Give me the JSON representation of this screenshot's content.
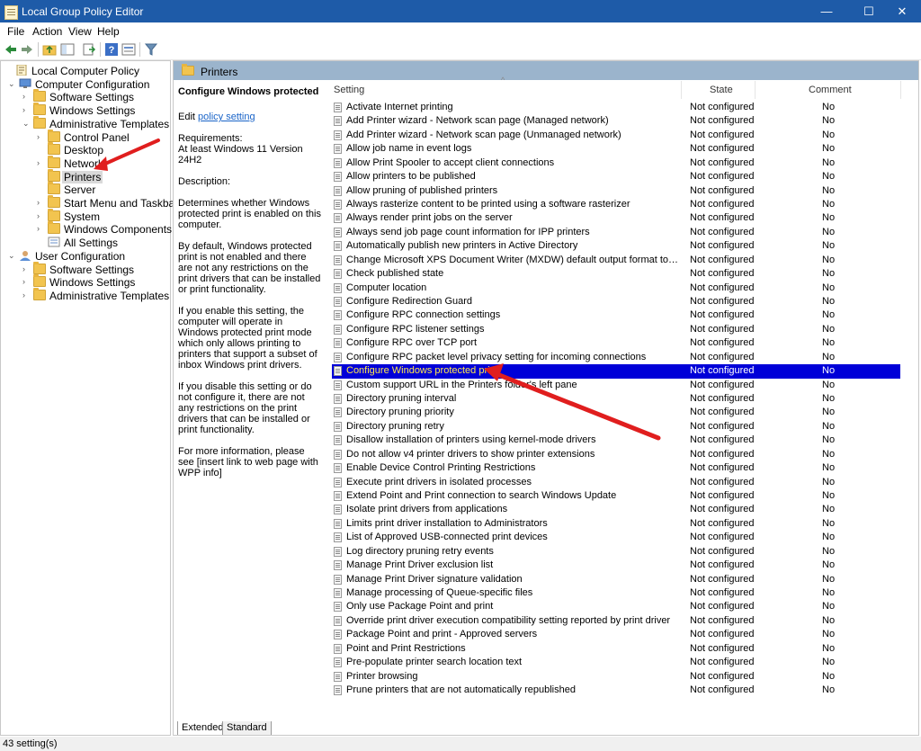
{
  "window": {
    "title": "Local Group Policy Editor",
    "minimize": "—",
    "maximize": "☐",
    "close": "✕"
  },
  "menu": [
    "File",
    "Action",
    "View",
    "Help"
  ],
  "tree": [
    {
      "label": "Local Computer Policy",
      "level": 0,
      "icon": "policy-icon",
      "expander": ""
    },
    {
      "label": "Computer Configuration",
      "level": 1,
      "icon": "computer-icon",
      "expander": "⌄"
    },
    {
      "label": "Software Settings",
      "level": 2,
      "icon": "folder-icon",
      "expander": "›"
    },
    {
      "label": "Windows Settings",
      "level": 2,
      "icon": "folder-icon",
      "expander": "›"
    },
    {
      "label": "Administrative Templates",
      "level": 2,
      "icon": "folder-icon",
      "expander": "⌄"
    },
    {
      "label": "Control Panel",
      "level": 3,
      "icon": "folder-icon",
      "expander": "›"
    },
    {
      "label": "Desktop",
      "level": 3,
      "icon": "folder-icon",
      "expander": ""
    },
    {
      "label": "Network",
      "level": 3,
      "icon": "folder-icon",
      "expander": "›"
    },
    {
      "label": "Printers",
      "level": 3,
      "icon": "folder-icon",
      "expander": "",
      "selected": true
    },
    {
      "label": "Server",
      "level": 3,
      "icon": "folder-icon",
      "expander": ""
    },
    {
      "label": "Start Menu and Taskbar",
      "level": 3,
      "icon": "folder-icon",
      "expander": "›"
    },
    {
      "label": "System",
      "level": 3,
      "icon": "folder-icon",
      "expander": "›"
    },
    {
      "label": "Windows Components",
      "level": 3,
      "icon": "folder-icon",
      "expander": "›"
    },
    {
      "label": "All Settings",
      "level": 3,
      "icon": "all-settings-icon",
      "expander": ""
    },
    {
      "label": "User Configuration",
      "level": 1,
      "icon": "user-icon",
      "expander": "⌄"
    },
    {
      "label": "Software Settings",
      "level": 2,
      "icon": "folder-icon",
      "expander": "›"
    },
    {
      "label": "Windows Settings",
      "level": 2,
      "icon": "folder-icon",
      "expander": "›"
    },
    {
      "label": "Administrative Templates",
      "level": 2,
      "icon": "folder-icon",
      "expander": "›"
    }
  ],
  "pane": {
    "header": "Printers",
    "desc_title": "Configure Windows protected print",
    "edit_prefix": "Edit ",
    "edit_link": "policy setting",
    "requirements_label": "Requirements:",
    "requirements": "At least Windows 11 Version 24H2",
    "description_label": "Description:",
    "p1": "Determines whether Windows protected print is enabled on this computer.",
    "p2": "By default, Windows protected print is not enabled and there are not any restrictions on the print drivers that can be installed or print functionality.",
    "p3": "If you enable this setting, the computer will operate in Windows protected print mode which only allows printing to printers that support a subset of inbox Windows print drivers.",
    "p4": "If you disable this setting or do not configure it, there are not any restrictions on the print drivers that can be installed or print functionality.",
    "p5": "For more information, please see [insert link to web page with WPP info]"
  },
  "columns": {
    "setting": "Setting",
    "state": "State",
    "comment": "Comment"
  },
  "rows": [
    {
      "name": "Activate Internet printing",
      "state": "Not configured",
      "comment": "No"
    },
    {
      "name": "Add Printer wizard - Network scan page (Managed network)",
      "state": "Not configured",
      "comment": "No"
    },
    {
      "name": "Add Printer wizard - Network scan page (Unmanaged network)",
      "state": "Not configured",
      "comment": "No"
    },
    {
      "name": "Allow job name in event logs",
      "state": "Not configured",
      "comment": "No"
    },
    {
      "name": "Allow Print Spooler to accept client connections",
      "state": "Not configured",
      "comment": "No"
    },
    {
      "name": "Allow printers to be published",
      "state": "Not configured",
      "comment": "No"
    },
    {
      "name": "Allow pruning of published printers",
      "state": "Not configured",
      "comment": "No"
    },
    {
      "name": "Always rasterize content to be printed using a software rasterizer",
      "state": "Not configured",
      "comment": "No"
    },
    {
      "name": "Always render print jobs on the server",
      "state": "Not configured",
      "comment": "No"
    },
    {
      "name": "Always send job page count information for IPP printers",
      "state": "Not configured",
      "comment": "No"
    },
    {
      "name": "Automatically publish new printers in Active Directory",
      "state": "Not configured",
      "comment": "No"
    },
    {
      "name": "Change Microsoft XPS Document Writer (MXDW) default output format to the legacy ...",
      "state": "Not configured",
      "comment": "No"
    },
    {
      "name": "Check published state",
      "state": "Not configured",
      "comment": "No"
    },
    {
      "name": "Computer location",
      "state": "Not configured",
      "comment": "No"
    },
    {
      "name": "Configure Redirection Guard",
      "state": "Not configured",
      "comment": "No"
    },
    {
      "name": "Configure RPC connection settings",
      "state": "Not configured",
      "comment": "No"
    },
    {
      "name": "Configure RPC listener settings",
      "state": "Not configured",
      "comment": "No"
    },
    {
      "name": "Configure RPC over TCP port",
      "state": "Not configured",
      "comment": "No"
    },
    {
      "name": "Configure RPC packet level privacy setting for incoming connections",
      "state": "Not configured",
      "comment": "No"
    },
    {
      "name": "Configure Windows protected print",
      "state": "Not configured",
      "comment": "No",
      "selected": true
    },
    {
      "name": "Custom support URL in the Printers folder's left pane",
      "state": "Not configured",
      "comment": "No"
    },
    {
      "name": "Directory pruning interval",
      "state": "Not configured",
      "comment": "No"
    },
    {
      "name": "Directory pruning priority",
      "state": "Not configured",
      "comment": "No"
    },
    {
      "name": "Directory pruning retry",
      "state": "Not configured",
      "comment": "No"
    },
    {
      "name": "Disallow installation of printers using kernel-mode drivers",
      "state": "Not configured",
      "comment": "No"
    },
    {
      "name": "Do not allow v4 printer drivers to show printer extensions",
      "state": "Not configured",
      "comment": "No"
    },
    {
      "name": "Enable Device Control Printing Restrictions",
      "state": "Not configured",
      "comment": "No"
    },
    {
      "name": "Execute print drivers in isolated processes",
      "state": "Not configured",
      "comment": "No"
    },
    {
      "name": "Extend Point and Print connection to search Windows Update",
      "state": "Not configured",
      "comment": "No"
    },
    {
      "name": "Isolate print drivers from applications",
      "state": "Not configured",
      "comment": "No"
    },
    {
      "name": "Limits print driver installation to Administrators",
      "state": "Not configured",
      "comment": "No"
    },
    {
      "name": "List of Approved USB-connected print devices",
      "state": "Not configured",
      "comment": "No"
    },
    {
      "name": "Log directory pruning retry events",
      "state": "Not configured",
      "comment": "No"
    },
    {
      "name": "Manage Print Driver exclusion list",
      "state": "Not configured",
      "comment": "No"
    },
    {
      "name": "Manage Print Driver signature validation",
      "state": "Not configured",
      "comment": "No"
    },
    {
      "name": "Manage processing of Queue-specific files",
      "state": "Not configured",
      "comment": "No"
    },
    {
      "name": "Only use Package Point and print",
      "state": "Not configured",
      "comment": "No"
    },
    {
      "name": "Override print driver execution compatibility setting reported by print driver",
      "state": "Not configured",
      "comment": "No"
    },
    {
      "name": "Package Point and print - Approved servers",
      "state": "Not configured",
      "comment": "No"
    },
    {
      "name": "Point and Print Restrictions",
      "state": "Not configured",
      "comment": "No"
    },
    {
      "name": "Pre-populate printer search location text",
      "state": "Not configured",
      "comment": "No"
    },
    {
      "name": "Printer browsing",
      "state": "Not configured",
      "comment": "No"
    },
    {
      "name": "Prune printers that are not automatically republished",
      "state": "Not configured",
      "comment": "No"
    }
  ],
  "tabs": [
    "Extended",
    "Standard"
  ],
  "status": "43 setting(s)",
  "colors": {
    "titlebar": "#1e5ba8",
    "selection": "#0000d8",
    "selection_text": "#ffe84d",
    "pane_header": "#9bb4cc",
    "annotation_arrow": "#e01e1e"
  }
}
